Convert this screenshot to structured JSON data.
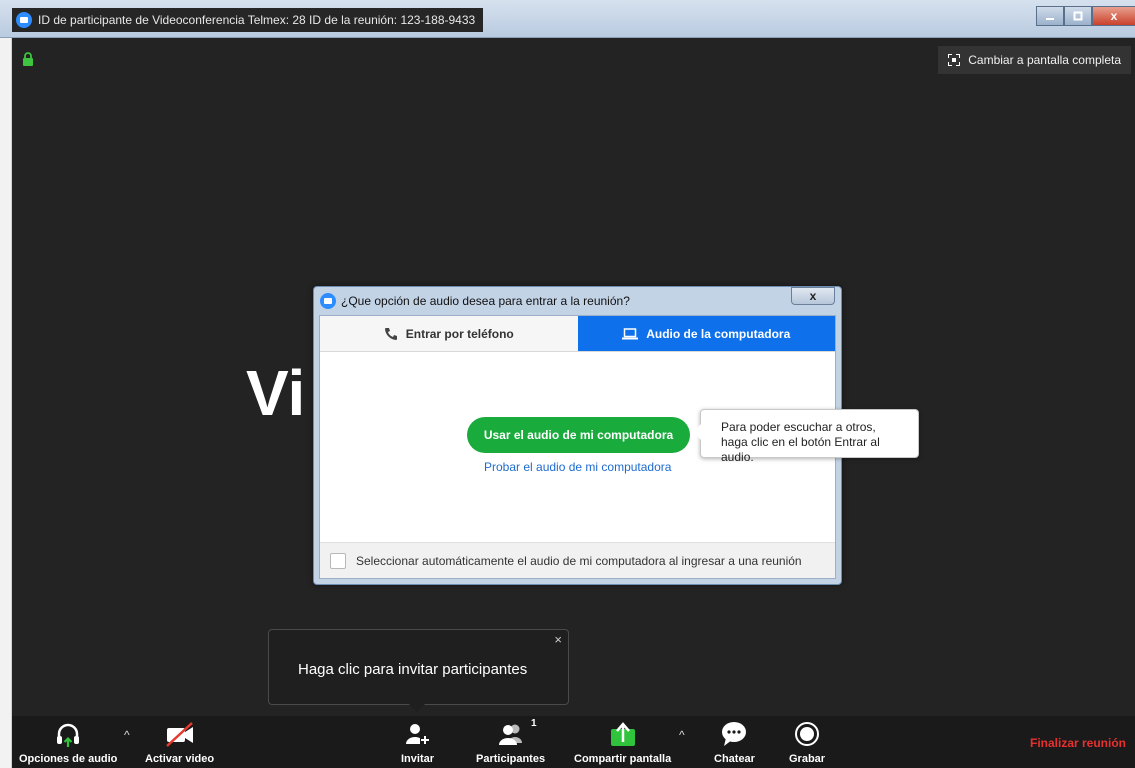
{
  "window": {
    "title": "ID de participante de Videoconferencia Telmex: 28   ID de la reunión: 123-188-9433",
    "close_glyph": "x"
  },
  "stage": {
    "fullscreen_label": "Cambiar a pantalla completa",
    "name_text": "Vi"
  },
  "dialog": {
    "title": "¿Que opción de audio desea para entrar a la reunión?",
    "close_glyph": "x",
    "tabs": [
      {
        "label": "Entrar por teléfono"
      },
      {
        "label": "Audio de la computadora"
      }
    ],
    "join_button": "Usar el audio de mi computadora",
    "test_link": "Probar el audio de mi computadora",
    "tooltip": "Para poder escuchar a otros, haga clic en el botón Entrar al audio.",
    "auto_select_label": "Seleccionar automáticamente el audio de mi computadora al ingresar a una reunión"
  },
  "invite_popover": {
    "text": "Haga clic para invitar participantes",
    "close_glyph": "×"
  },
  "toolbar": {
    "audio_options": "Opciones de audio",
    "start_video": "Activar video",
    "invite": "Invitar",
    "participants": "Participantes",
    "participants_count": "1",
    "share_screen": "Compartir pantalla",
    "chat": "Chatear",
    "record": "Grabar",
    "end_meeting": "Finalizar reunión",
    "caret_glyph": "^"
  },
  "colors": {
    "accent_blue": "#0e71eb",
    "join_green": "#1aab3d",
    "end_red": "#e8312f"
  }
}
